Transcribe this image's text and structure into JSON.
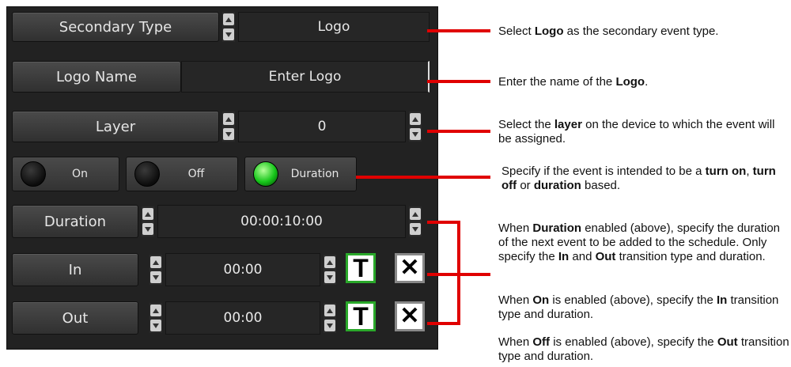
{
  "panel": {
    "secondary_type": {
      "label": "Secondary Type",
      "value": "Logo"
    },
    "logo_name": {
      "label": "Logo Name",
      "value": "Enter Logo"
    },
    "layer": {
      "label": "Layer",
      "value": "0"
    },
    "mode_toggles": [
      {
        "label": "On",
        "active": false
      },
      {
        "label": "Off",
        "active": false
      },
      {
        "label": "Duration",
        "active": true
      }
    ],
    "duration": {
      "label": "Duration",
      "value": "00:00:10:00"
    },
    "in": {
      "label": "In",
      "value": "00:00"
    },
    "out": {
      "label": "Out",
      "value": "00:00"
    },
    "t_icon": "T",
    "x_icon": "✕"
  },
  "annotations": {
    "a1": {
      "pre": "Select ",
      "b1": "Logo",
      "post": " as the secondary event type."
    },
    "a2": {
      "pre": "Enter the name of the ",
      "b1": "Logo",
      "post": "."
    },
    "a3": {
      "pre": "Select the ",
      "b1": "layer",
      "post": " on the device to which the event will be assigned."
    },
    "a4": {
      "pre": "Specify if the event is intended to be a ",
      "b1": "turn on",
      "mid1": ", ",
      "b2": "turn off",
      "mid2": " or ",
      "b3": "duration",
      "post": " based."
    },
    "a5": {
      "pre": "When ",
      "b1": "Duration",
      "mid1": " enabled (above), specify the duration of the next event to be added to the schedule. Only specify the ",
      "b2": "In",
      "mid2": " and ",
      "b3": "Out",
      "post": " transition type and duration."
    },
    "a6": {
      "pre": "When ",
      "b1": "On",
      "mid1": " is enabled (above), specify the ",
      "b2": "In",
      "post": " transition type and duration."
    },
    "a7": {
      "pre": "When ",
      "b1": "Off",
      "mid1": " is enabled (above), specify the ",
      "b2": "Out",
      "post": " transition type and duration."
    }
  },
  "colors": {
    "accent_red": "#e00000",
    "led_green": "#16c61a",
    "t_border": "#2aa82a"
  }
}
